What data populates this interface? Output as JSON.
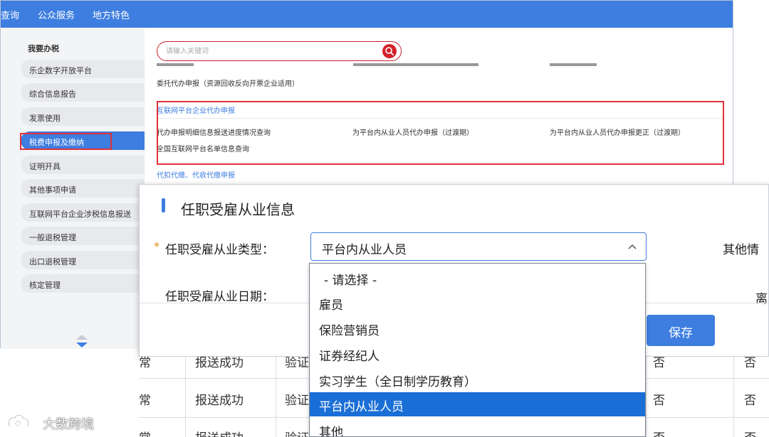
{
  "topnav": {
    "items": [
      "查询",
      "公众服务",
      "地方特色"
    ]
  },
  "sidebar": {
    "title": "我要办税",
    "items": [
      "乐企数字开放平台",
      "综合信息报告",
      "发票使用",
      "税费申报及缴纳",
      "证明开具",
      "其他事项申请",
      "互联网平台企业涉税信息报送",
      "一般退税管理",
      "出口退税管理",
      "核定管理"
    ],
    "active_index": 3
  },
  "search": {
    "placeholder": "请输入关键词"
  },
  "content": {
    "entrust_link": "委托代办申报（资源回收反向开票企业适用）",
    "internet_section_title": "互联网平台企业代办申报",
    "internet_links": [
      "代办申报明细信息报送进度情况查询",
      "为平台内从业人员代办申报（过渡期）",
      "为平台内从业人员代办申报更正（过渡期）",
      "全国互联网平台名单信息查询"
    ],
    "withholding_section_title": "代扣代缴、代收代缴申报"
  },
  "dialog": {
    "title": "任职受雇从业信息",
    "required_mark": "*",
    "type_label": "任职受雇从业类型：",
    "type_value": "平台内从业人员",
    "other_info_label": "其他情",
    "date_label": "任职受雇从业日期：",
    "leave_label": "离",
    "save_label": "保存"
  },
  "dropdown": {
    "options": [
      "- 请选择 -",
      "雇员",
      "保险营销员",
      "证券经纪人",
      "实习学生（全日制学历教育）",
      "平台内从业人员",
      "其他"
    ],
    "selected_index": 5
  },
  "table": {
    "rows": [
      {
        "c1": "常",
        "c2": "报送成功",
        "c3": "验证",
        "c4": "否",
        "c5": "否"
      },
      {
        "c1": "常",
        "c2": "报送成功",
        "c3": "验证",
        "c4": "否",
        "c5": "否"
      },
      {
        "c1": "常",
        "c2": "报送成功",
        "c3": "验证",
        "c4": "否",
        "c5": "否"
      }
    ]
  },
  "watermark": {
    "text": "大数跨境"
  },
  "colors": {
    "brand_blue": "#3d7ee0",
    "highlight_red": "#e0303a",
    "selected_blue": "#1a6fd6"
  }
}
